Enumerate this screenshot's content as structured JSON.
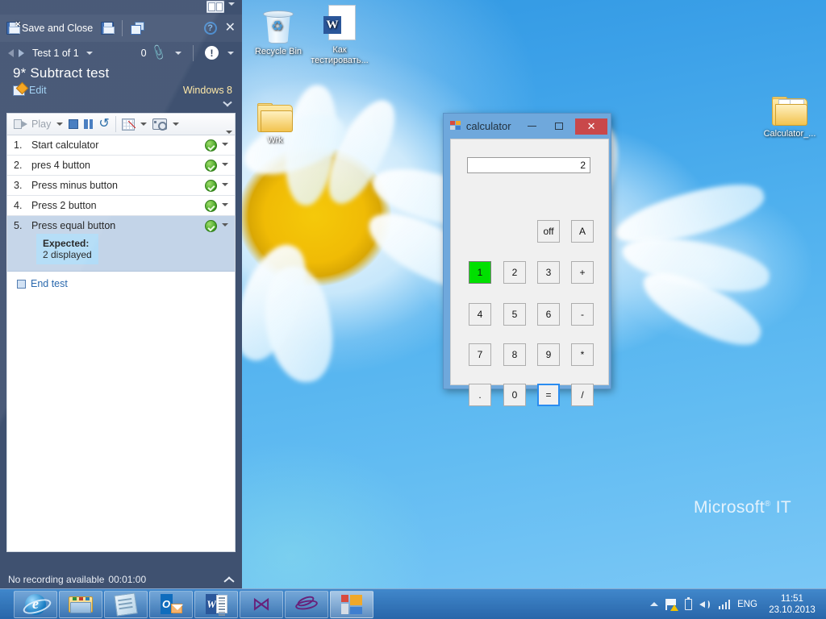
{
  "desktop": {
    "icons": [
      {
        "name": "recycle-bin",
        "label": "Recycle Bin"
      },
      {
        "name": "word-doc",
        "label": "Как\nтестировать..."
      },
      {
        "name": "folder-wrk",
        "label": "Wrk"
      },
      {
        "name": "folder-calculator",
        "label": "Calculator_..."
      }
    ],
    "watermark": "Microsoft",
    "watermark_sup": "®",
    "watermark_tail": "IT"
  },
  "runner": {
    "command_bar": {
      "save_and_close": "Save and Close",
      "save_icon": "floppy-save-icon",
      "copy_icon": "copy-windows-icon",
      "help_icon": "help-icon",
      "close_icon": "close-icon"
    },
    "nav": {
      "test_counter": "Test 1 of 1",
      "attachment_count": "0",
      "attachment_icon": "paperclip-icon",
      "info_icon": "info-icon"
    },
    "title": "9* Subtract test",
    "edit_label": "Edit",
    "configuration": "Windows 8",
    "toolbar": {
      "play": "Play",
      "stop_icon": "stop-icon",
      "pause_icon": "pause-icon",
      "undo_icon": "undo-icon",
      "grid_icon": "data-grid-icon",
      "camera_icon": "camera-icon"
    },
    "steps": [
      {
        "num": "1.",
        "text": "Start calculator",
        "status": "passed"
      },
      {
        "num": "2.",
        "text": "pres 4 button",
        "status": "passed"
      },
      {
        "num": "3.",
        "text": "Press minus button",
        "status": "passed"
      },
      {
        "num": "4.",
        "text": "Press 2 button",
        "status": "passed"
      },
      {
        "num": "5.",
        "text": "Press equal button",
        "status": "passed",
        "selected": true
      }
    ],
    "expected": {
      "label": "Expected:",
      "value": "2 displayed"
    },
    "end_test": "End test",
    "status": {
      "recording": "No recording available",
      "duration": "00:01:00"
    }
  },
  "calculator": {
    "title": "calculator",
    "display_value": "2",
    "minimize_label": "",
    "maximize_label": "",
    "close_label": "✕",
    "keys": [
      {
        "label": "off",
        "row": 0,
        "col": 2,
        "state": "normal"
      },
      {
        "label": "A",
        "row": 0,
        "col": 3,
        "state": "normal"
      },
      {
        "label": "1",
        "row": 1,
        "col": 0,
        "state": "highlight"
      },
      {
        "label": "2",
        "row": 1,
        "col": 1,
        "state": "normal"
      },
      {
        "label": "3",
        "row": 1,
        "col": 2,
        "state": "normal"
      },
      {
        "label": "+",
        "row": 1,
        "col": 3,
        "state": "normal"
      },
      {
        "label": "4",
        "row": 2,
        "col": 0,
        "state": "normal"
      },
      {
        "label": "5",
        "row": 2,
        "col": 1,
        "state": "normal"
      },
      {
        "label": "6",
        "row": 2,
        "col": 2,
        "state": "normal"
      },
      {
        "label": "-",
        "row": 2,
        "col": 3,
        "state": "normal"
      },
      {
        "label": "7",
        "row": 3,
        "col": 0,
        "state": "normal"
      },
      {
        "label": "8",
        "row": 3,
        "col": 1,
        "state": "normal"
      },
      {
        "label": "9",
        "row": 3,
        "col": 2,
        "state": "normal"
      },
      {
        "label": "*",
        "row": 3,
        "col": 3,
        "state": "normal"
      },
      {
        "label": ".",
        "row": 4,
        "col": 0,
        "state": "normal"
      },
      {
        "label": "0",
        "row": 4,
        "col": 1,
        "state": "normal"
      },
      {
        "label": "=",
        "row": 4,
        "col": 2,
        "state": "focus"
      },
      {
        "label": "/",
        "row": 4,
        "col": 3,
        "state": "normal"
      }
    ],
    "colors": {
      "highlight": "#00e000",
      "focus_border": "#2a8cf0",
      "close_bg": "#c9484a"
    }
  },
  "taskbar": {
    "apps": [
      {
        "name": "internet-explorer",
        "active": false
      },
      {
        "name": "file-explorer",
        "active": false
      },
      {
        "name": "notepad",
        "active": false
      },
      {
        "name": "outlook",
        "active": false
      },
      {
        "name": "word",
        "active": false
      },
      {
        "name": "visual-studio",
        "active": false
      },
      {
        "name": "test-manager",
        "active": false
      },
      {
        "name": "calculator-app",
        "active": true
      }
    ],
    "tray": {
      "show_hidden_icon": "chevron-up-icon",
      "action_center_icon": "flag-warning-icon",
      "battery_icon": "battery-icon",
      "volume_icon": "speaker-icon",
      "network_icon": "signal-bars-icon",
      "language": "ENG",
      "time": "11:51",
      "date": "23.10.2013"
    }
  }
}
